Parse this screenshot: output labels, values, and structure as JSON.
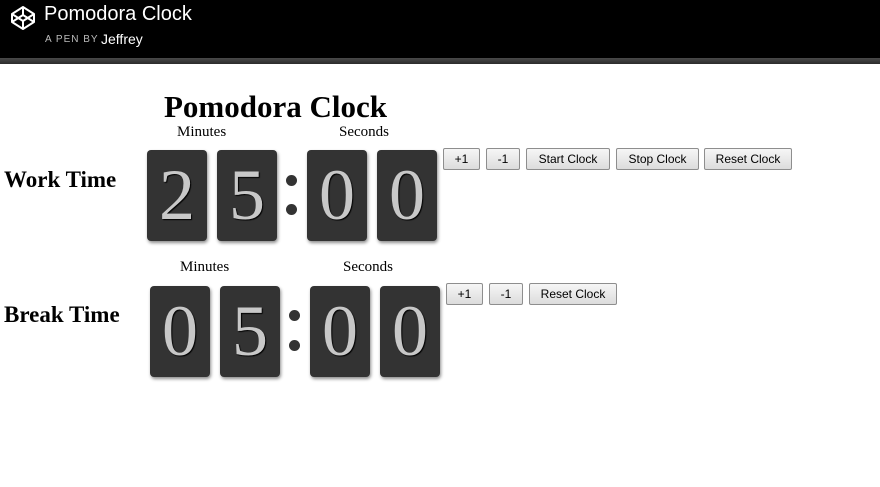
{
  "header": {
    "title": "Pomodora Clock",
    "by_label": "A PEN BY",
    "author": "Jeffrey",
    "logo_icon": "codepen-logo-icon"
  },
  "page": {
    "title": "Pomodora Clock"
  },
  "work": {
    "label": "Work Time",
    "minutes_label": "Minutes",
    "seconds_label": "Seconds",
    "digits": [
      "2",
      "5",
      "0",
      "0"
    ],
    "buttons": {
      "plus": "+1",
      "minus": "-1",
      "start": "Start Clock",
      "stop": "Stop Clock",
      "reset": "Reset Clock"
    }
  },
  "break": {
    "label": "Break Time",
    "minutes_label": "Minutes",
    "seconds_label": "Seconds",
    "digits": [
      "0",
      "5",
      "0",
      "0"
    ],
    "buttons": {
      "plus": "+1",
      "minus": "-1",
      "reset": "Reset Clock"
    }
  },
  "colors": {
    "digit_bg": "#333333",
    "digit_fg": "#c8c8c8",
    "header_bg": "#000000"
  }
}
